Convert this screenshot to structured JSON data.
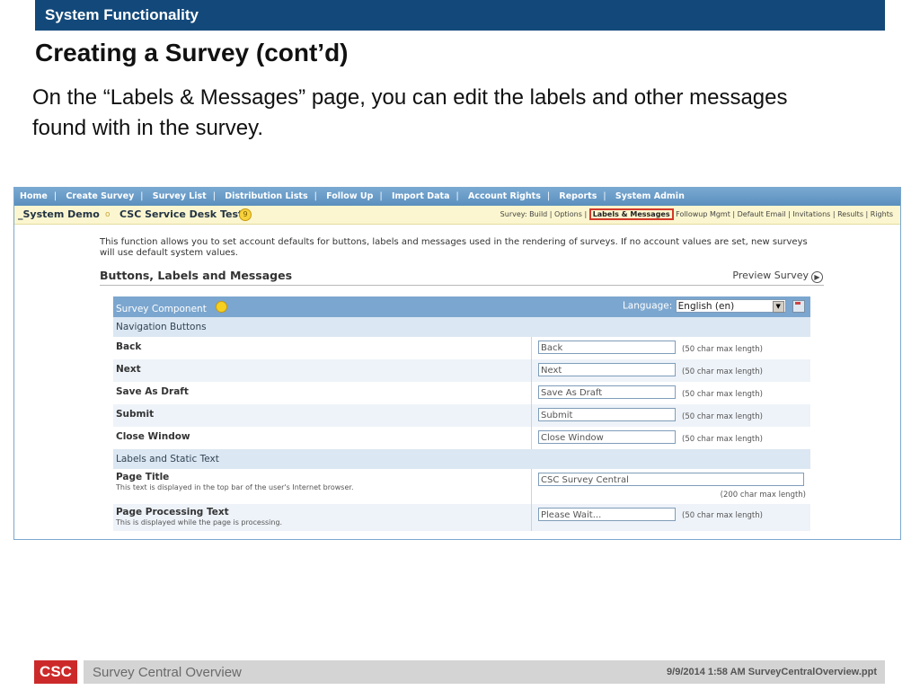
{
  "slide": {
    "header": "System Functionality",
    "title": "Creating a Survey (cont’d)",
    "body": "On the “Labels & Messages” page, you can edit the labels and other messages found with in the survey."
  },
  "app": {
    "nav": [
      "Home",
      "Create Survey",
      "Survey List",
      "Distribution Lists",
      "Follow Up",
      "Import Data",
      "Account Rights",
      "Reports",
      "System Admin"
    ],
    "subbar": {
      "demo": "_System Demo",
      "circle": "o",
      "survey_title": "CSC Service Desk Test",
      "survey_prefix": "Survey: ",
      "links": [
        "Build",
        "Options",
        "Labels & Messages",
        "Followup Mgmt",
        "Default Email",
        "Invitations",
        "Results",
        "Rights"
      ]
    },
    "description": "This function allows you to set account defaults for buttons, labels and messages used in the rendering of surveys. If no account values are set, new surveys will use default system values.",
    "section_title": "Buttons, Labels and Messages",
    "preview_label": "Preview Survey",
    "grid": {
      "component_label": "Survey Component",
      "language_label": "Language:",
      "language_value": "English (en)",
      "cat_nav": "Navigation Buttons",
      "cat_labels": "Labels and Static Text",
      "rows": [
        {
          "label": "Back",
          "value": "Back",
          "hint": "(50 char max length)"
        },
        {
          "label": "Next",
          "value": "Next",
          "hint": "(50 char max length)"
        },
        {
          "label": "Save As Draft",
          "value": "Save As Draft",
          "hint": "(50 char max length)"
        },
        {
          "label": "Submit",
          "value": "Submit",
          "hint": "(50 char max length)"
        },
        {
          "label": "Close Window",
          "value": "Close Window",
          "hint": "(50 char max length)"
        }
      ],
      "page_title": {
        "label": "Page Title",
        "desc": "This text is displayed in the top bar of the user's Internet browser.",
        "value": "CSC Survey Central",
        "hint": "(200 char max length)"
      },
      "processing": {
        "label": "Page Processing Text",
        "desc": "This is displayed while the page is processing.",
        "value": "Please Wait...",
        "hint": "(50 char max length)"
      }
    }
  },
  "footer": {
    "logo": "CSC",
    "left": "Survey Central Overview",
    "right": "9/9/2014 1:58 AM  SurveyCentralOverview.ppt"
  }
}
